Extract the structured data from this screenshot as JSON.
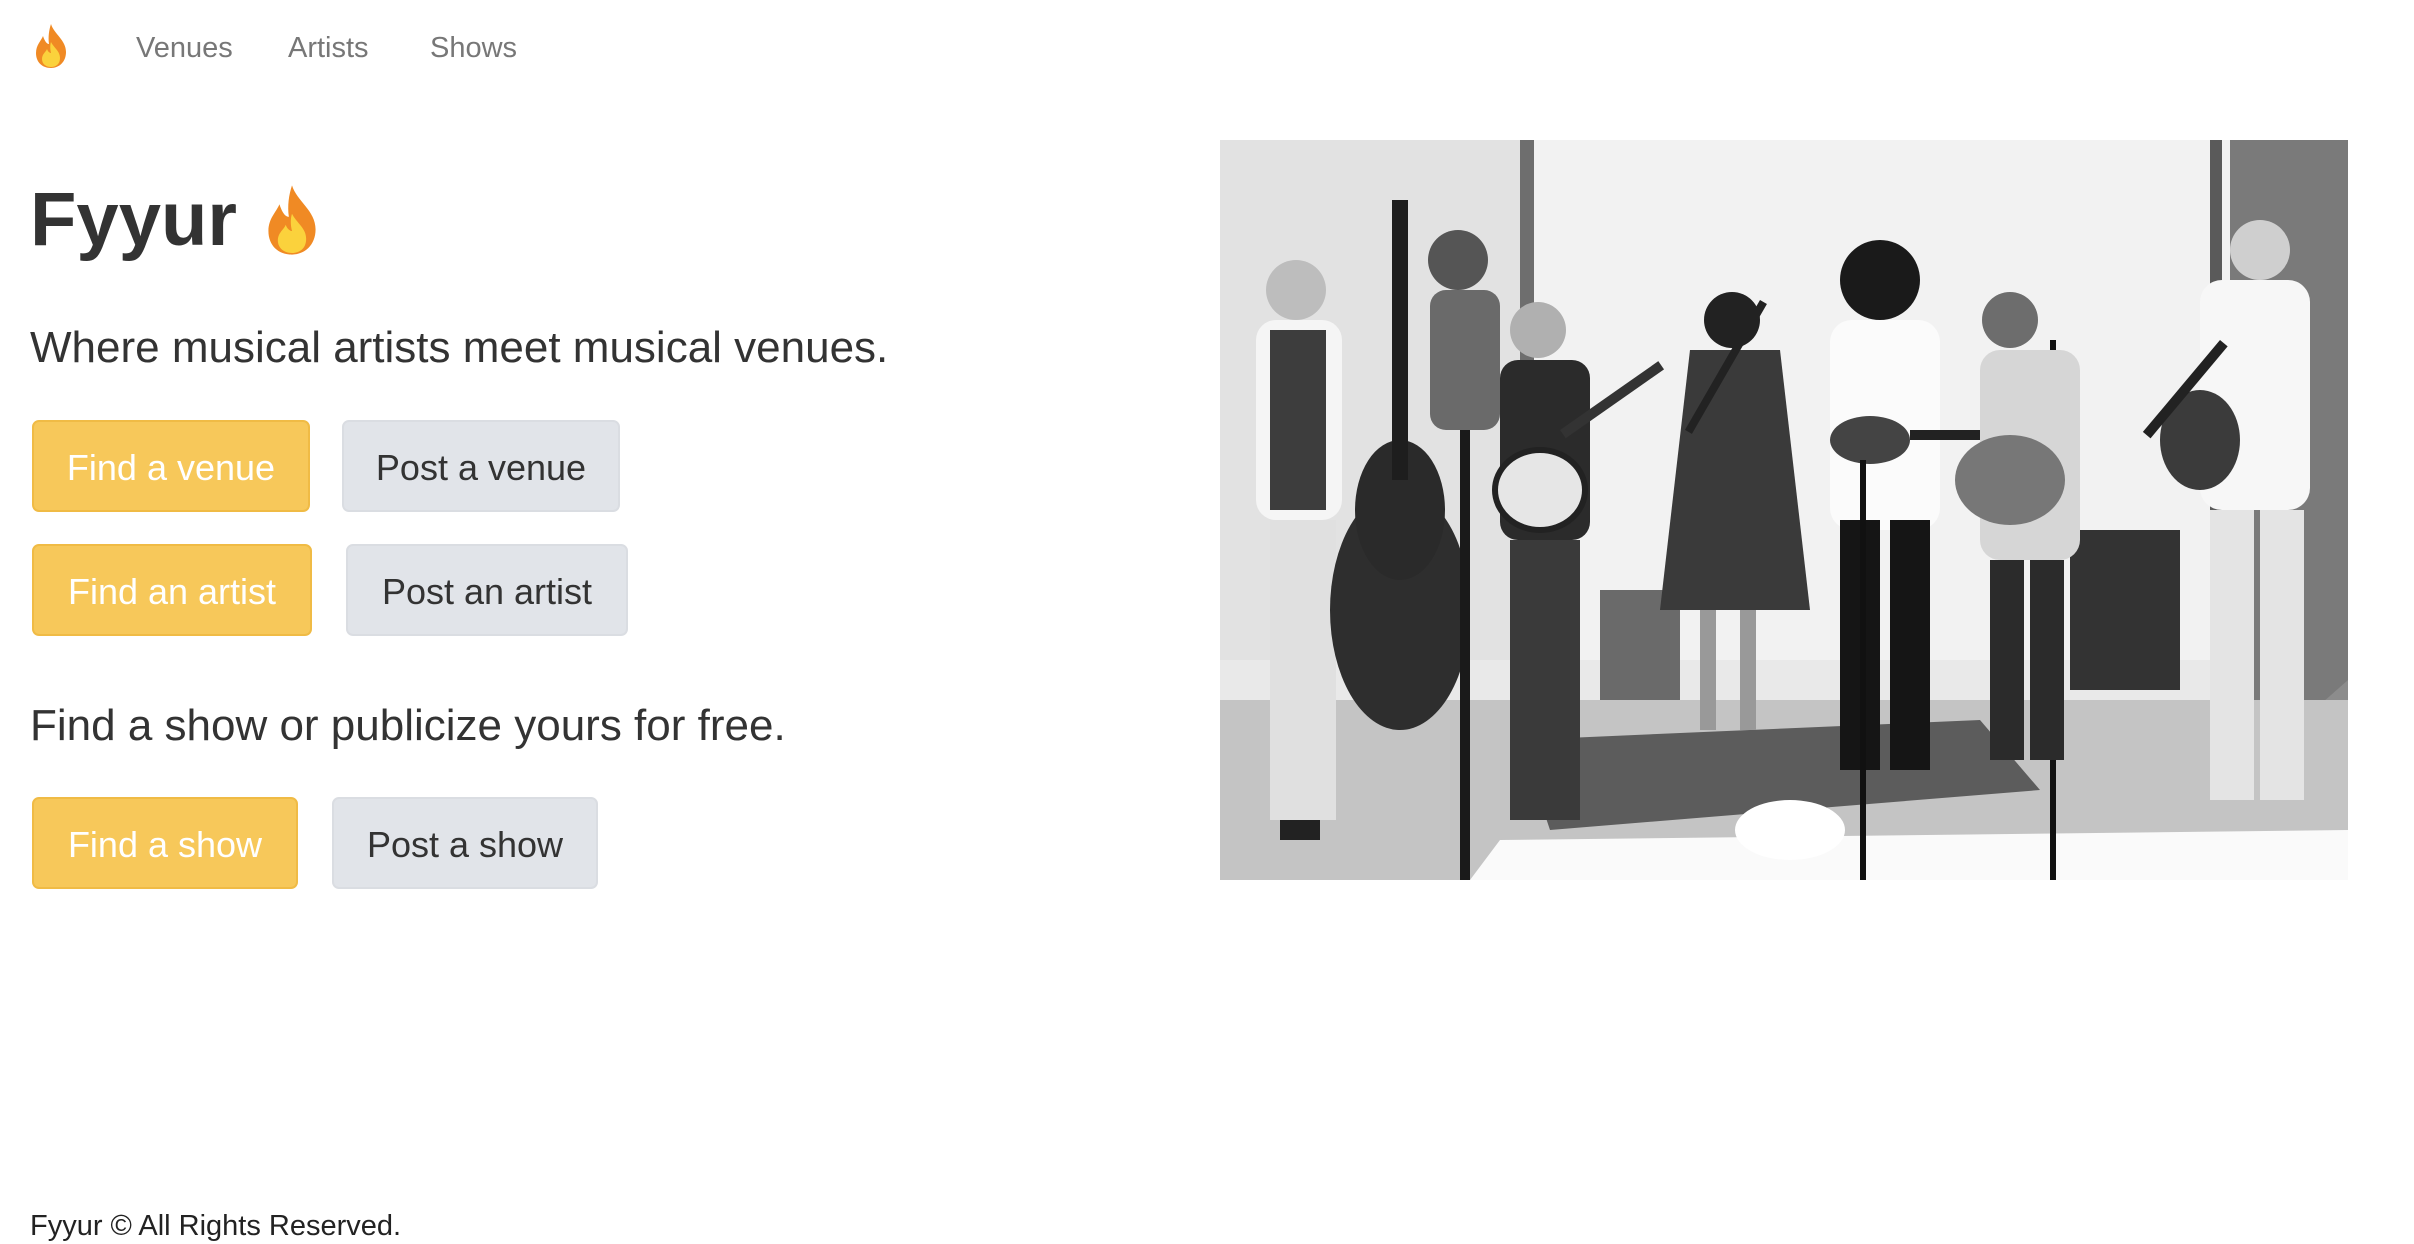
{
  "navbar": {
    "brand_icon": "flame-icon",
    "links": [
      {
        "label": "Venues"
      },
      {
        "label": "Artists"
      },
      {
        "label": "Shows"
      }
    ]
  },
  "hero": {
    "title": "Fyyur",
    "title_icon": "flame-icon",
    "tagline": "Where musical artists meet musical venues.",
    "venue_buttons": {
      "find": "Find a venue",
      "post": "Post a venue"
    },
    "artist_buttons": {
      "find": "Find an artist",
      "post": "Post an artist"
    },
    "show_tagline": "Find a show or publicize yours for free.",
    "show_buttons": {
      "find": "Find a show",
      "post": "Post a show"
    }
  },
  "image": {
    "subject": "black-and-white photo of a bluegrass band performing"
  },
  "footer": {
    "text": "Fyyur © All Rights Reserved."
  },
  "colors": {
    "primary_button": "#f7c85a",
    "secondary_button": "#e1e4e9",
    "nav_text": "#777777",
    "body_text": "#333333"
  }
}
